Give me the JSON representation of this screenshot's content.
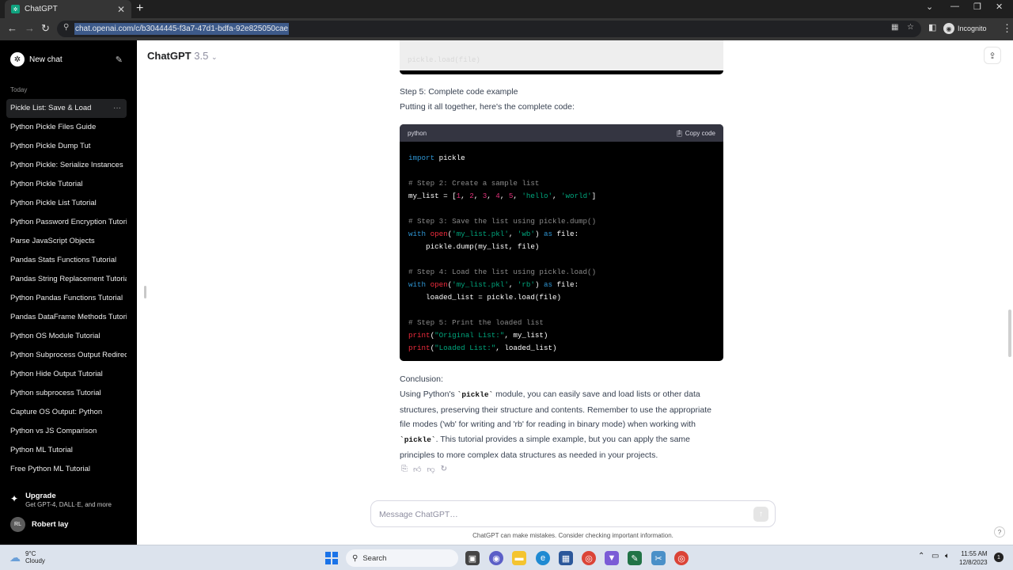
{
  "browser": {
    "tab_title": "ChatGPT",
    "tab_close": "✕",
    "new_tab": "+",
    "url": "chat.openai.com/c/b3044445-f3a7-47d1-bdfa-92e825050cae",
    "incognito_label": "Incognito"
  },
  "sidebar": {
    "new_chat": "New chat",
    "section_today": "Today",
    "items": [
      "Pickle List: Save & Load",
      "Python Pickle Files Guide",
      "Python Pickle Dump Tut",
      "Python Pickle: Serialize Instances",
      "Python Pickle Tutorial",
      "Python Pickle List Tutorial",
      "Python Password Encryption Tutorial",
      "Parse JavaScript Objects",
      "Pandas Stats Functions Tutorial",
      "Pandas String Replacement Tutorial",
      "Python Pandas Functions Tutorial",
      "Pandas DataFrame Methods Tutorial",
      "Python OS Module Tutorial",
      "Python Subprocess Output Redirect",
      "Python Hide Output Tutorial",
      "Python subprocess Tutorial",
      "Capture OS Output: Python",
      "Python vs JS Comparison",
      "Python ML Tutorial",
      "Free Python ML Tutorial"
    ],
    "active_more": "···",
    "upgrade_title": "Upgrade",
    "upgrade_sub": "Get GPT-4, DALL·E, and more",
    "user_initials": "RL",
    "user_name": "Robert lay"
  },
  "header": {
    "model_name": "ChatGPT",
    "model_version": "3.5"
  },
  "message": {
    "step5_heading": "Step 5: Complete code example",
    "step5_intro": "Putting it all together, here's the complete code:",
    "code_lang": "python",
    "copy_code": "Copy code",
    "conclusion_heading": "Conclusion:",
    "conclusion_parts": {
      "p1": "Using Python's ",
      "code1": "`pickle`",
      "p2": " module, you can easily save and load lists or other data structures, preserving their structure and contents. Remember to use the appropriate file modes ('wb' for writing and 'rb' for reading in binary mode) when working with ",
      "code2": "`pickle`",
      "p3": ". This tutorial provides a simple example, but you can apply the same principles to more complex data structures as needed in your projects."
    }
  },
  "composer": {
    "placeholder": "Message ChatGPT…",
    "disclaimer": "ChatGPT can make mistakes. Consider checking important information.",
    "help": "?"
  },
  "taskbar": {
    "temp": "9°C",
    "weather": "Cloudy",
    "search": "Search",
    "time": "11:55 AM",
    "date": "12/8/2023",
    "notif_count": "1"
  },
  "colors": {
    "keyword": "#2e95d3",
    "string": "#00a67d",
    "number": "#df3079",
    "comment": "#8a8a8a"
  }
}
